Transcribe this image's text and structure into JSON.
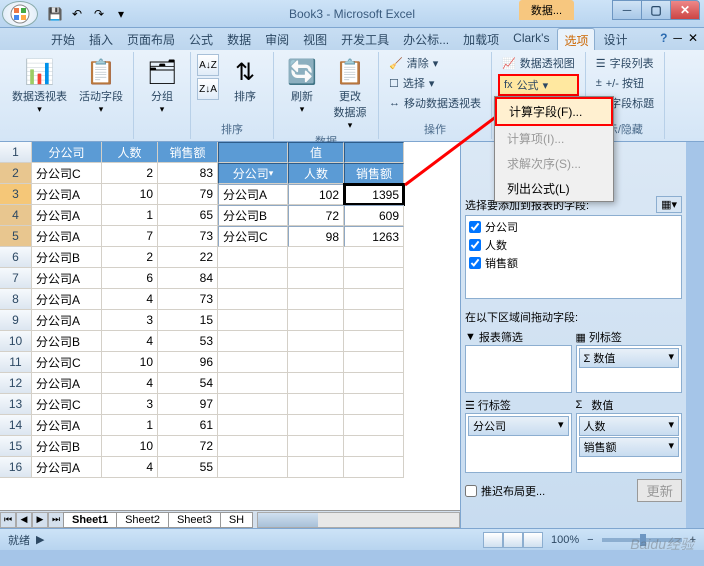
{
  "title": "Book3 - Microsoft Excel",
  "context_tab": "数据...",
  "tabs": [
    "开始",
    "插入",
    "页面布局",
    "公式",
    "数据",
    "审阅",
    "视图",
    "开发工具",
    "办公标...",
    "加载项",
    "Clark's",
    "选项",
    "设计"
  ],
  "ribbon": {
    "g1": {
      "b1": "数据透视表",
      "b2": "活动字段"
    },
    "g2": {
      "b1": "分组",
      "label": ""
    },
    "g3": {
      "b1": "排序",
      "label": "排序"
    },
    "g4": {
      "b1": "刷新",
      "b2": "更改\n数据源",
      "label": "数据"
    },
    "g5": {
      "i1": "清除",
      "i2": "选择",
      "i3": "移动数据透视表",
      "label": "操作"
    },
    "g6": {
      "i1": "数据透视图",
      "i2": "公式"
    },
    "g7": {
      "i1": "字段列表",
      "i2": "+/- 按钮",
      "i3": "字段标题",
      "label": "示/隐藏"
    }
  },
  "menu": {
    "i1": "计算字段(F)...",
    "i2": "计算项(I)...",
    "i3": "求解次序(S)...",
    "i4": "列出公式(L)"
  },
  "sheet": {
    "hdr": [
      "分公司",
      "人数",
      "销售额"
    ],
    "pv_val": "值",
    "pv_hdr": [
      "分公司",
      "人数",
      "销售额"
    ],
    "rows": [
      {
        "r": 2,
        "c": [
          "分公司C",
          "2",
          "83"
        ]
      },
      {
        "r": 3,
        "c": [
          "分公司A",
          "10",
          "79"
        ],
        "pv": [
          "分公司A",
          "102",
          "1395"
        ]
      },
      {
        "r": 4,
        "c": [
          "分公司A",
          "1",
          "65"
        ],
        "pv": [
          "分公司B",
          "72",
          "609"
        ]
      },
      {
        "r": 5,
        "c": [
          "分公司A",
          "7",
          "73"
        ],
        "pv": [
          "分公司C",
          "98",
          "1263"
        ]
      },
      {
        "r": 6,
        "c": [
          "分公司B",
          "2",
          "22"
        ]
      },
      {
        "r": 7,
        "c": [
          "分公司A",
          "6",
          "84"
        ]
      },
      {
        "r": 8,
        "c": [
          "分公司A",
          "4",
          "73"
        ]
      },
      {
        "r": 9,
        "c": [
          "分公司A",
          "3",
          "15"
        ]
      },
      {
        "r": 10,
        "c": [
          "分公司B",
          "4",
          "53"
        ]
      },
      {
        "r": 11,
        "c": [
          "分公司C",
          "10",
          "96"
        ]
      },
      {
        "r": 12,
        "c": [
          "分公司A",
          "4",
          "54"
        ]
      },
      {
        "r": 13,
        "c": [
          "分公司C",
          "3",
          "97"
        ]
      },
      {
        "r": 14,
        "c": [
          "分公司A",
          "1",
          "61"
        ]
      },
      {
        "r": 15,
        "c": [
          "分公司B",
          "10",
          "72"
        ]
      },
      {
        "r": 16,
        "c": [
          "分公司A",
          "4",
          "55"
        ]
      }
    ],
    "tabs": [
      "Sheet1",
      "Sheet2",
      "Sheet3",
      "SH"
    ]
  },
  "pane": {
    "fields_label": "选择要添加到报表的字段:",
    "fields": [
      "分公司",
      "人数",
      "销售额"
    ],
    "areas_label": "在以下区域间拖动字段:",
    "filter": "报表筛选",
    "col": "列标签",
    "row": "行标签",
    "val": "数值",
    "col_item": "Σ 数值",
    "row_item": "分公司",
    "val_items": [
      "人数",
      "销售额"
    ],
    "defer": "推迟布局更..."
  },
  "status": {
    "ready": "就绪",
    "zoom": "100%"
  },
  "watermark": "Baidu经验"
}
